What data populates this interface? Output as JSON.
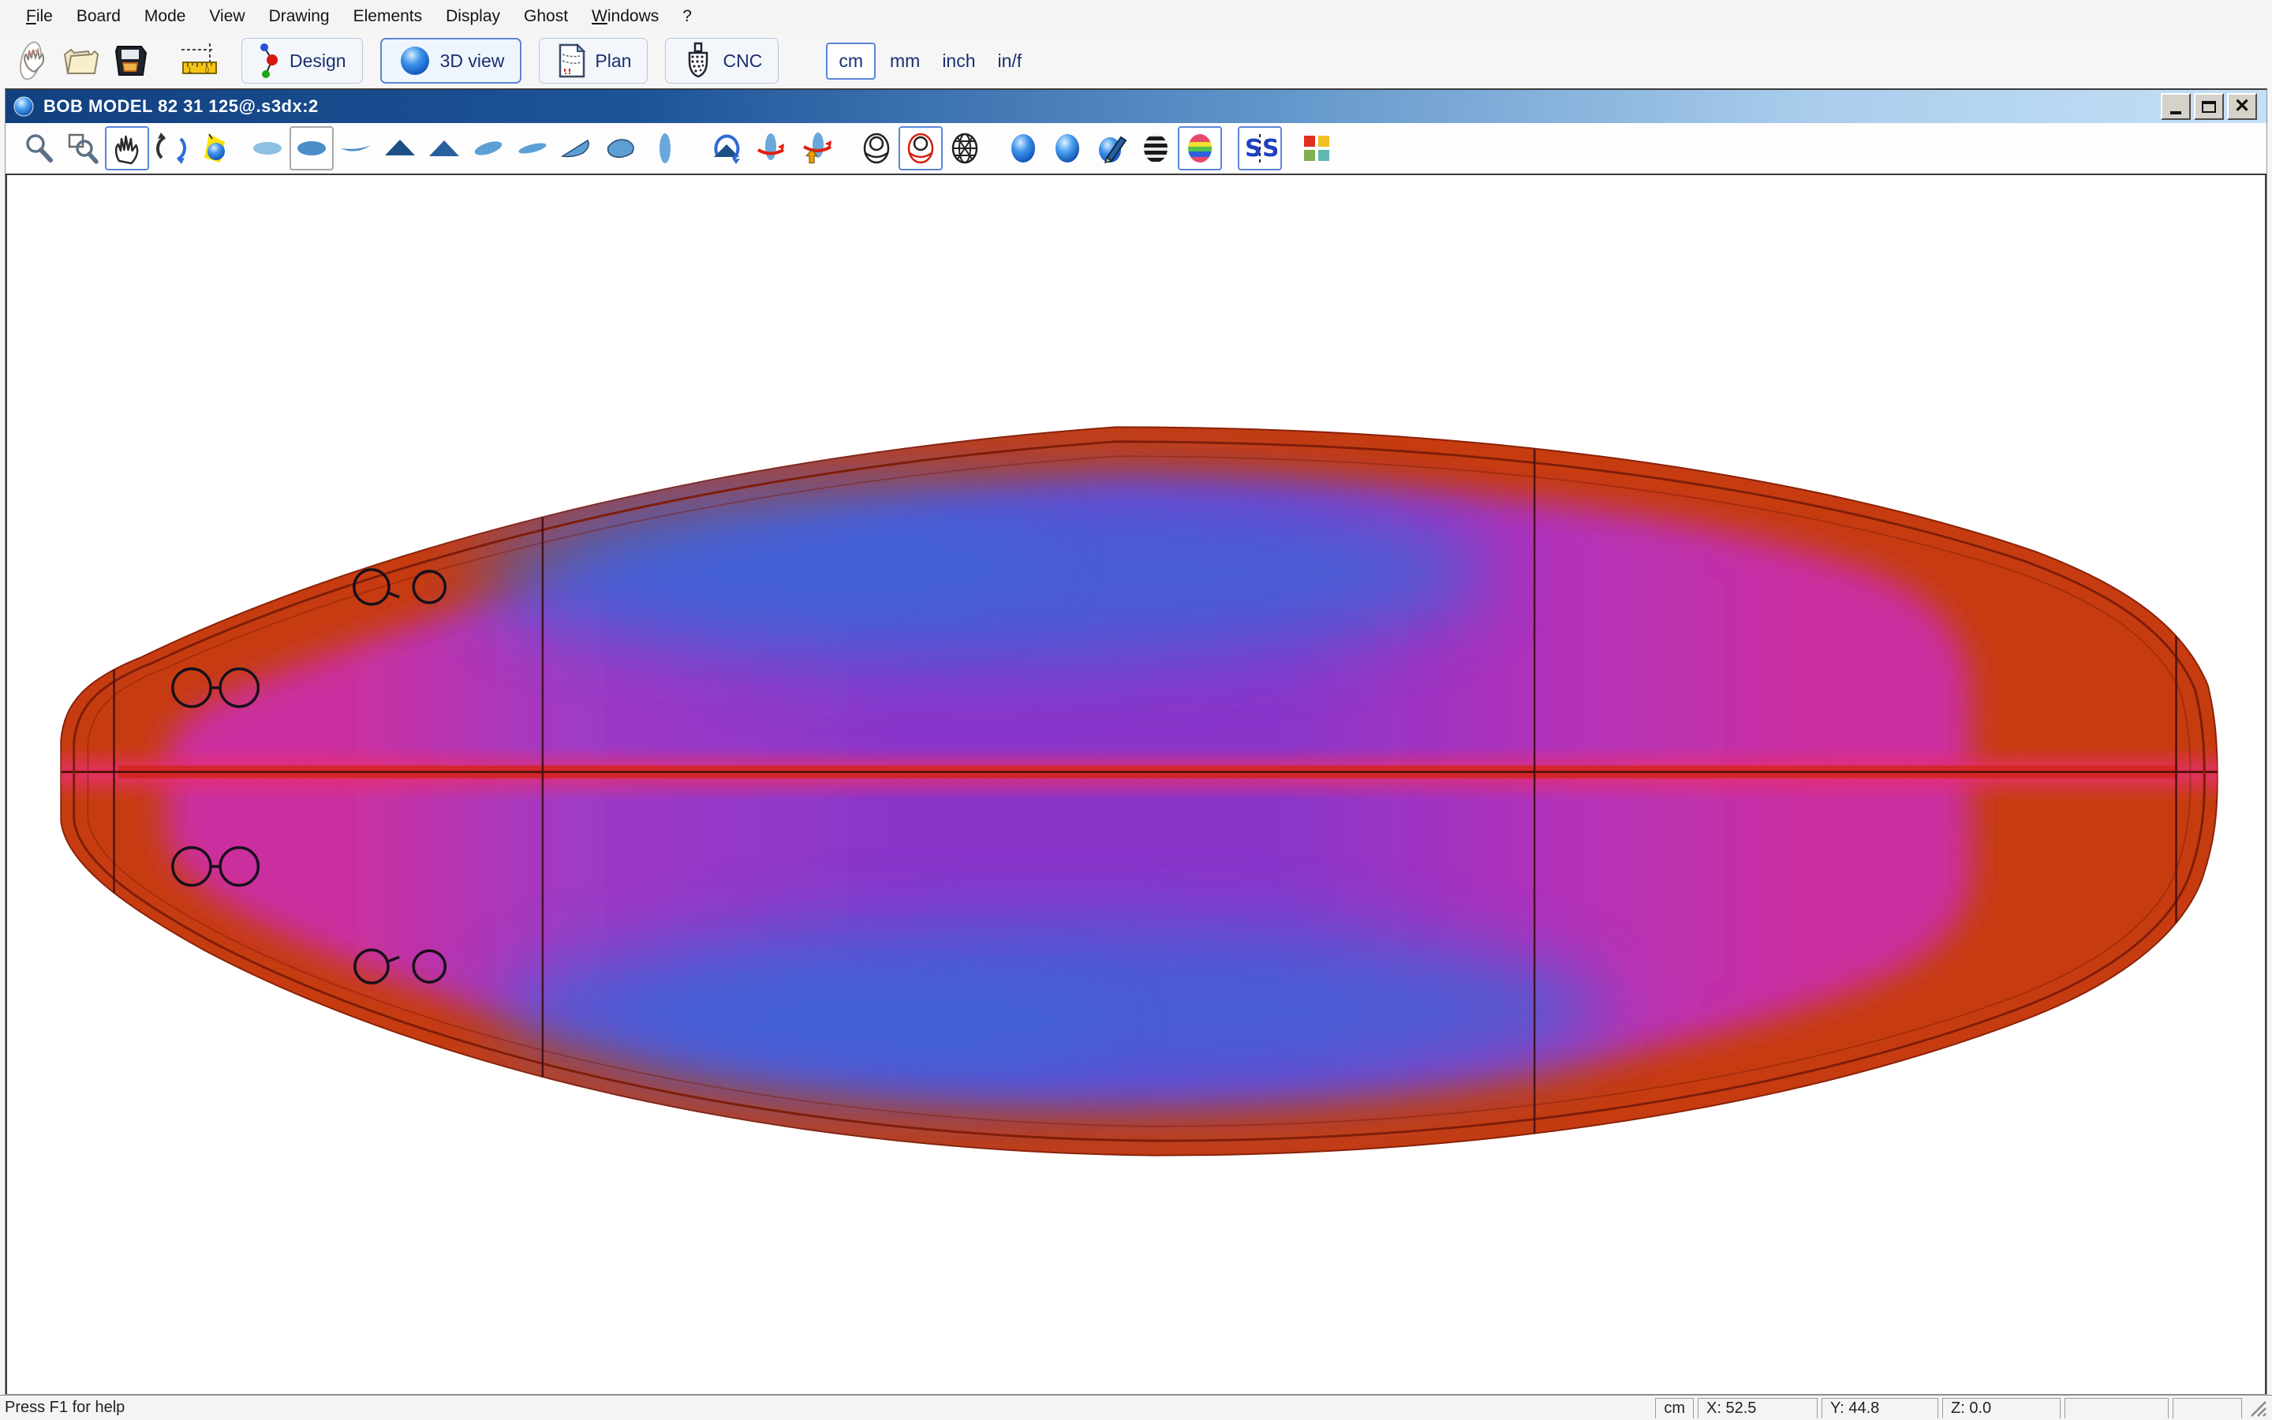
{
  "menu": {
    "items": [
      {
        "label": "File"
      },
      {
        "label": "Board"
      },
      {
        "label": "Mode"
      },
      {
        "label": "View"
      },
      {
        "label": "Drawing"
      },
      {
        "label": "Elements"
      },
      {
        "label": "Display"
      },
      {
        "label": "Ghost"
      },
      {
        "label": "Windows"
      },
      {
        "label": "?"
      }
    ]
  },
  "toolbar": {
    "design_label": "Design",
    "view3d_label": "3D view",
    "plan_label": "Plan",
    "cnc_label": "CNC",
    "units": {
      "cm": "cm",
      "mm": "mm",
      "inch": "inch",
      "inf": "in/f"
    },
    "active_unit": "cm",
    "icon_names": [
      "new-board-icon",
      "open-folder-icon",
      "save-floppy-icon",
      "measurements-ruler-icon"
    ]
  },
  "window": {
    "title": "BOB MODEL 82 31 125@.s3dx:2"
  },
  "tools": {
    "icon_names": [
      "zoom-icon",
      "zoom-window-icon",
      "pan-hand-icon",
      "rotate-3d-icon",
      "lighting-icon",
      "view-top-icon",
      "view-outline-icon",
      "view-rocker-icon",
      "view-front-icon",
      "view-back-icon",
      "view-perspective-icon",
      "view-perspective-flat-icon",
      "view-quarter-icon",
      "view-three-quarter-icon",
      "view-side-icon",
      "rotate-view-icon",
      "spin-view-icon",
      "flip-view-icon",
      "render-wireframe-icon",
      "render-wireframe-red-icon",
      "render-mesh-icon",
      "render-shaded-icon",
      "render-smooth-icon",
      "render-painted-icon",
      "render-zebra-icon",
      "render-curvature-icon",
      "symmetry-check-icon",
      "color-settings-icon"
    ]
  },
  "statusbar": {
    "help": "Press F1 for help",
    "unit": "cm",
    "x": "X: 52.5",
    "y": "Y: 44.8",
    "z": "Z: 0.0"
  },
  "board": {
    "rail_color": "#c63c10",
    "outline_color": "#7c1d08",
    "rail_line_color": "#7e1d09",
    "magenta": "#cb2f9f",
    "violet": "#a03ac4",
    "purple": "#8a36ca",
    "mid_magenta": "#b530b8",
    "blue": "#3a66d8",
    "stringer_glow": "#e62e6e",
    "stringer_core": "#d2251c",
    "stringer_line": "#5c120a",
    "guide_line": "#401015",
    "plug_line": "#18101a",
    "canvas_bg": "#ffffff"
  }
}
